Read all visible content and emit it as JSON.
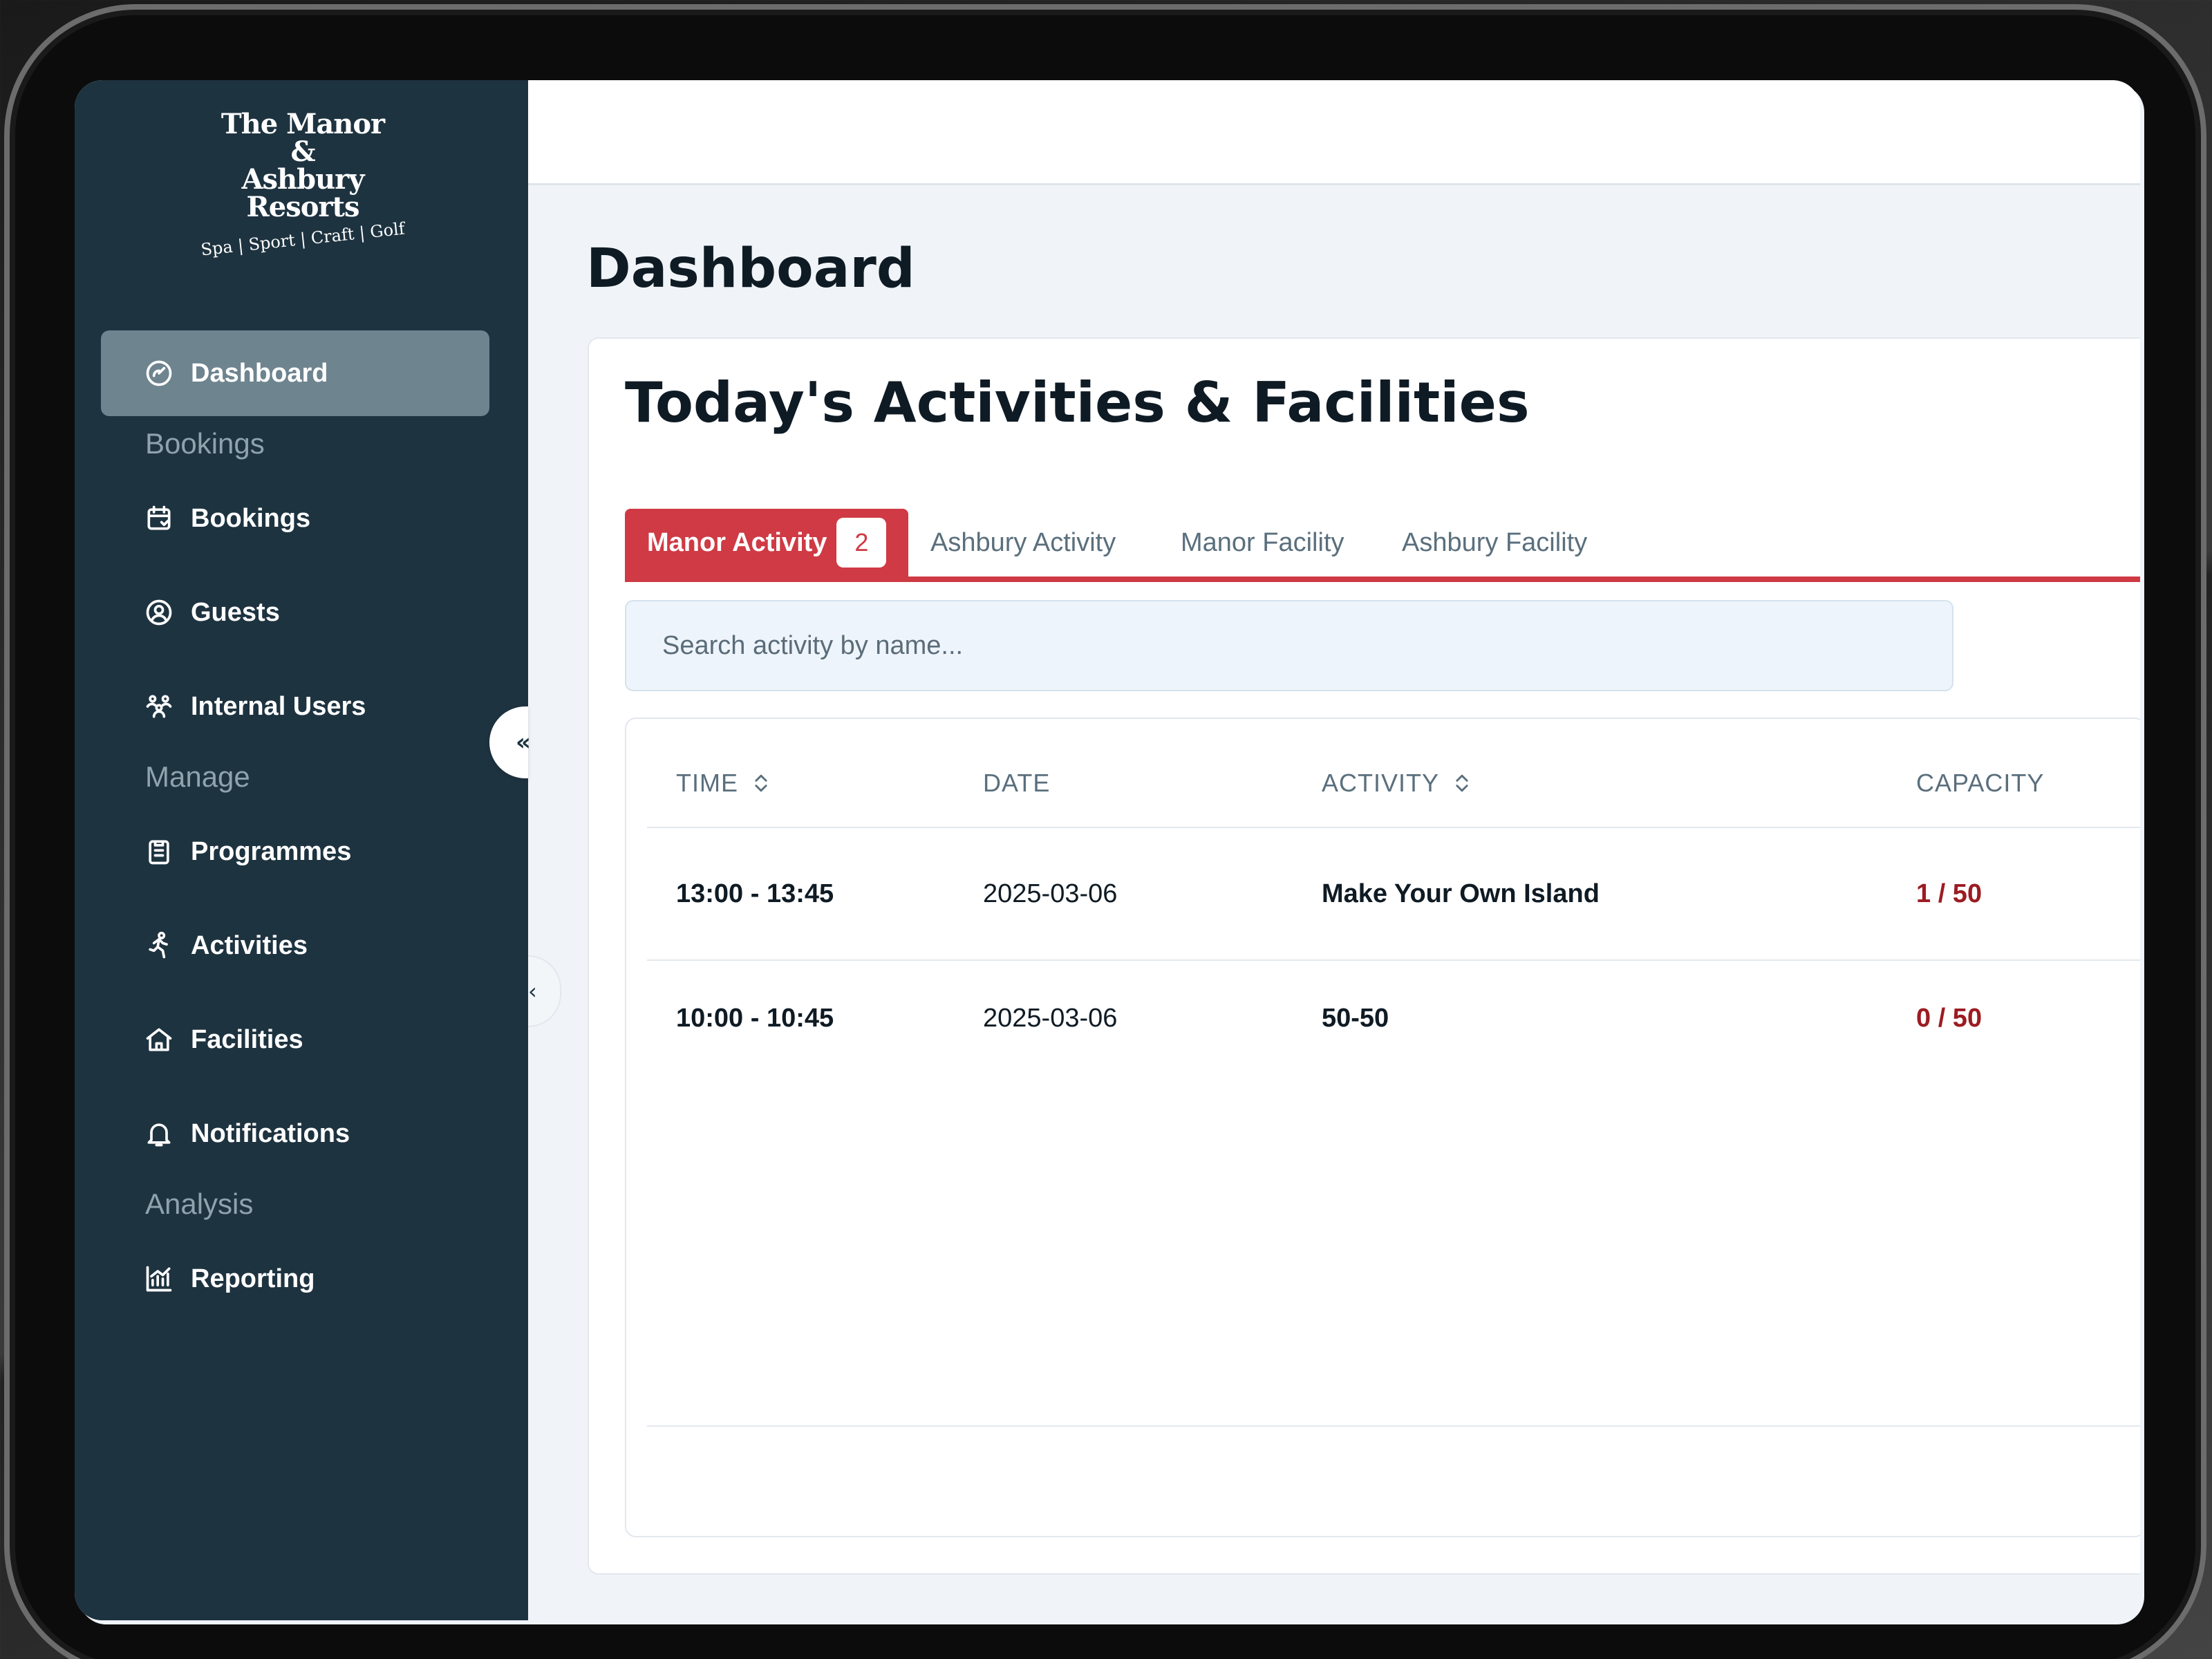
{
  "brand": {
    "logo_line1": "The Manor",
    "logo_line2": "&",
    "logo_line3": "Ashbury",
    "logo_line4": "Resorts",
    "logo_tagline": "Spa | Sport | Craft | Golf"
  },
  "sidebar": {
    "items": [
      {
        "label": "Dashboard",
        "icon": "gauge-icon",
        "active": true
      },
      {
        "section": "Bookings"
      },
      {
        "label": "Bookings",
        "icon": "calendar-icon"
      },
      {
        "label": "Guests",
        "icon": "user-circle-icon"
      },
      {
        "label": "Internal Users",
        "icon": "users-icon"
      },
      {
        "section": "Manage"
      },
      {
        "label": "Programmes",
        "icon": "clipboard-icon"
      },
      {
        "label": "Activities",
        "icon": "running-icon"
      },
      {
        "label": "Facilities",
        "icon": "home-icon"
      },
      {
        "label": "Notifications",
        "icon": "bell-icon"
      },
      {
        "section": "Analysis"
      },
      {
        "label": "Reporting",
        "icon": "chart-icon"
      }
    ],
    "collapse_icon": "chevron-double-left-icon"
  },
  "page": {
    "title": "Dashboard",
    "card_title": "Today's Activities & Facilities"
  },
  "tabs": [
    {
      "label": "Manor Activity",
      "badge": "2",
      "active": true
    },
    {
      "label": "Ashbury Activity"
    },
    {
      "label": "Manor Facility"
    },
    {
      "label": "Ashbury Facility"
    }
  ],
  "search": {
    "placeholder": "Search activity by name..."
  },
  "table": {
    "columns": [
      "TIME",
      "DATE",
      "ACTIVITY",
      "CAPACITY"
    ],
    "rows": [
      {
        "time": "13:00 - 13:45",
        "date": "2025-03-06",
        "activity": "Make Your Own Island",
        "capacity": "1 / 50"
      },
      {
        "time": "10:00 - 10:45",
        "date": "2025-03-06",
        "activity": "50-50",
        "capacity": "0 / 50"
      }
    ]
  },
  "colors": {
    "sidebar": "#1e3340",
    "accent": "#cf3a44",
    "capacity": "#9b1c22"
  }
}
